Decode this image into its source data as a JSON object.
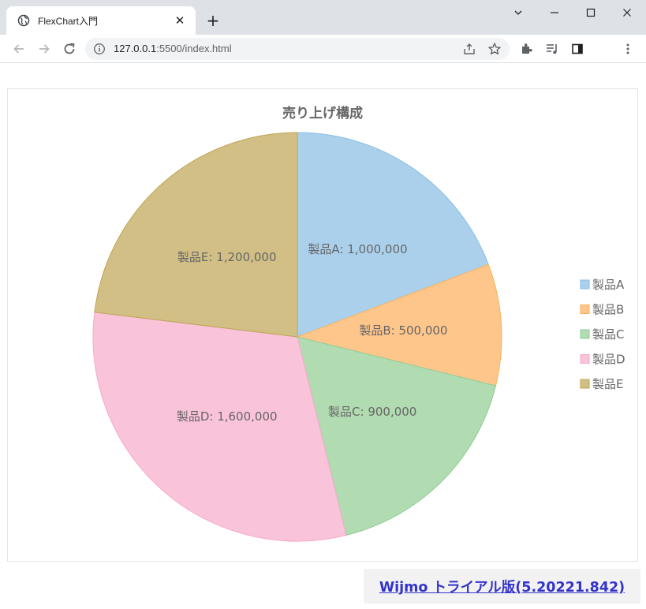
{
  "browser": {
    "tab_title": "FlexChart入門",
    "tab_close": "✕",
    "new_tab": "+",
    "url_host": "127.0.0.1",
    "url_rest": ":5500/index.html"
  },
  "page": {
    "trial_link": "Wijmo トライアル版(5.20221.842)"
  },
  "chart_data": {
    "type": "pie",
    "title": "売り上げ構成",
    "categories": [
      "製品A",
      "製品B",
      "製品C",
      "製品D",
      "製品E"
    ],
    "values": [
      1000000,
      500000,
      900000,
      1600000,
      1200000
    ],
    "labels": [
      "製品A: 1,000,000",
      "製品B: 500,000",
      "製品C: 900,000",
      "製品D: 1,600,000",
      "製品E: 1,200,000"
    ],
    "colors": [
      "#abd0ec",
      "#fec68b",
      "#b1dbb1",
      "#f9c3da",
      "#d2bf85"
    ],
    "borders": [
      "#88bde6",
      "#fbb258",
      "#90cd97",
      "#f6aac9",
      "#bfa554"
    ],
    "start_angle": "12 o'clock, clockwise",
    "legend": "right"
  }
}
